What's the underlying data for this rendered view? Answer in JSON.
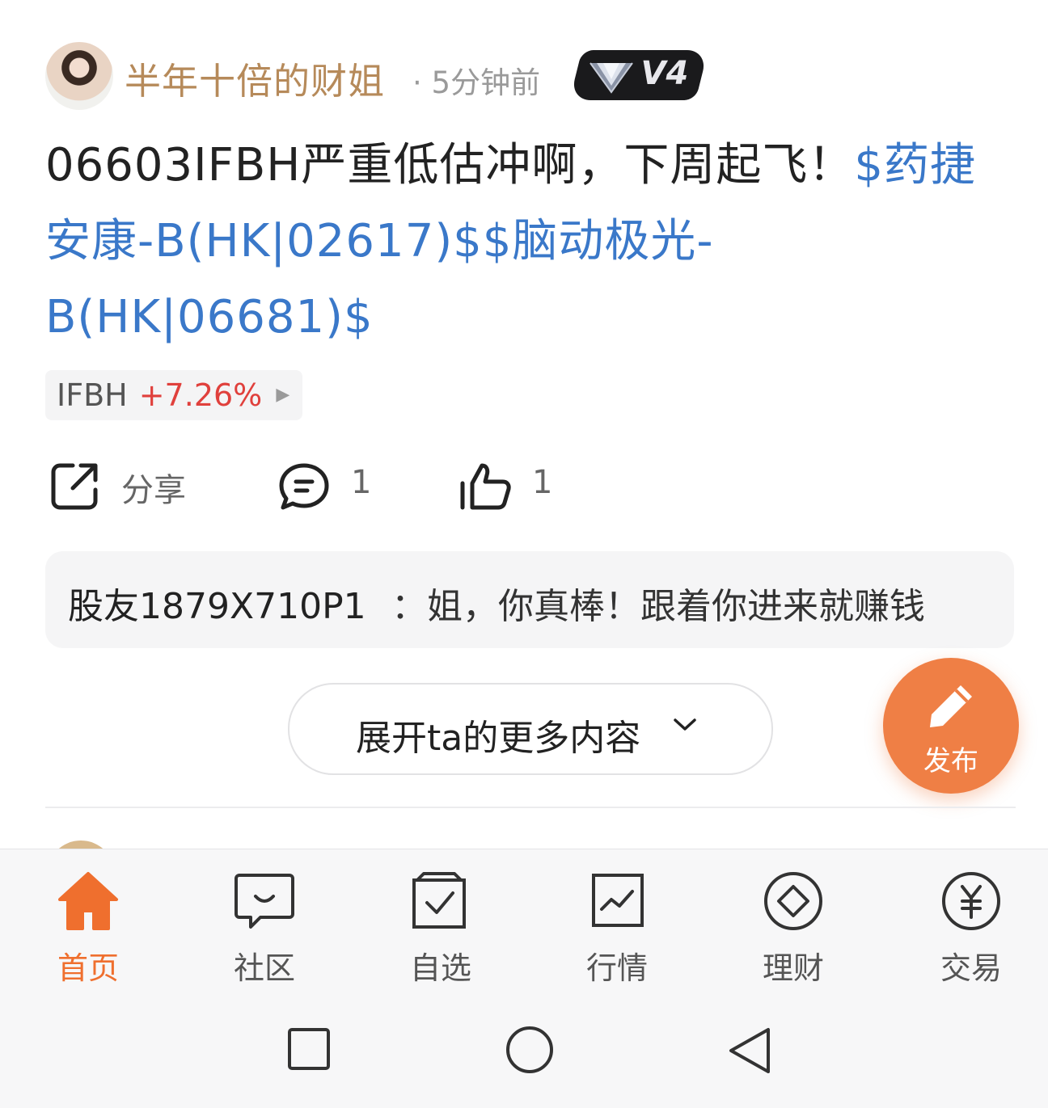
{
  "post": {
    "username": "半年十倍的财姐",
    "time": "· 5分钟前",
    "vip_level": "V4",
    "text": "06603IFBH严重低估冲啊，下周起飞！",
    "links": [
      "$药捷安康-B(HK|02617)$",
      "$脑动极光-B(HK|06681)$"
    ],
    "stock_chip": {
      "code": "IFBH",
      "change": "+7.26%"
    }
  },
  "actions": {
    "share_label": "分享",
    "comment_count": "1",
    "like_count": "1"
  },
  "comment": {
    "user": "股友1879X710P1",
    "text": "：姐，你真棒！跟着你进来就赚钱"
  },
  "expand_label": "展开ta的更多内容",
  "fab_label": "发布",
  "tabs": [
    {
      "label": "首页",
      "icon": "home-icon",
      "active": true
    },
    {
      "label": "社区",
      "icon": "chat-bubble-icon",
      "active": false
    },
    {
      "label": "自选",
      "icon": "checkbox-icon",
      "active": false
    },
    {
      "label": "行情",
      "icon": "chart-icon",
      "active": false
    },
    {
      "label": "理财",
      "icon": "diamond-circle-icon",
      "active": false
    },
    {
      "label": "交易",
      "icon": "yen-circle-icon",
      "active": false
    }
  ],
  "colors": {
    "accent": "#ef7f45",
    "link": "#3a78c9",
    "rise": "#e0403c",
    "username": "#b68a5a"
  }
}
